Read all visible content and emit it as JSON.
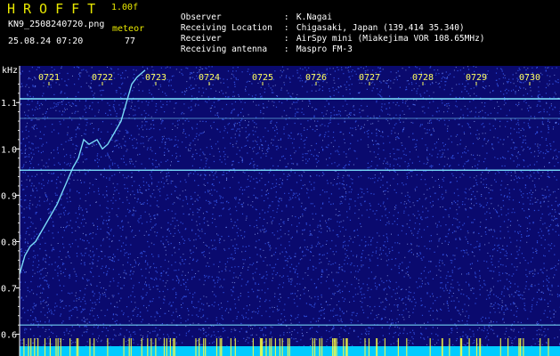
{
  "header": {
    "title": "HROFFT",
    "version": "1.00f",
    "filename": "KN9_2508240720.png",
    "mode": "meteor",
    "datetime": "25.08.24 07:20",
    "count": "77"
  },
  "station_info": [
    {
      "label": "Observer",
      "value": "K.Nagai"
    },
    {
      "label": "Receiving Location",
      "value": "Chigasaki, Japan (139.414 35.340)"
    },
    {
      "label": "Receiver",
      "value": "AirSpy mini (Miakejima VOR 108.65MHz)"
    },
    {
      "label": "Receiving antenna",
      "value": "Maspro FM-3"
    }
  ],
  "axis": {
    "y_unit": "kHz",
    "y_ticks": [
      "1.1",
      "1.0",
      "0.9",
      "0.8",
      "0.7",
      "0.6"
    ],
    "y_range": [
      0.58,
      1.16
    ],
    "time_ticks": [
      "0721",
      "0722",
      "0723",
      "0724",
      "0725",
      "0726",
      "0727",
      "0728",
      "0729",
      "0730"
    ],
    "time_range_minutes": [
      0,
      10
    ]
  },
  "colors": {
    "background": "#0a0a6e",
    "noise": "#3c64ff",
    "signal": "#7fe6ff",
    "strip": "#00ccff",
    "text_yellow": "#e8e800"
  }
}
